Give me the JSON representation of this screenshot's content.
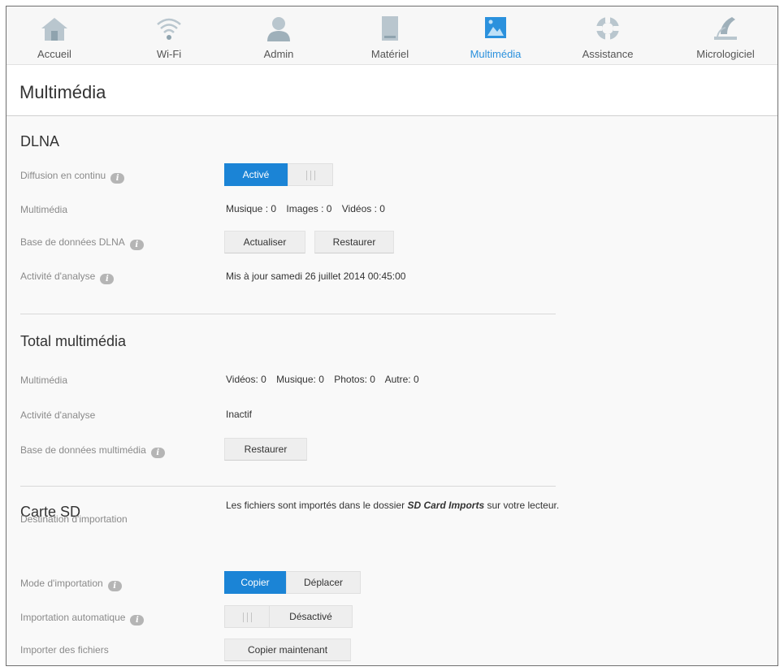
{
  "nav": {
    "items": [
      {
        "label": "Accueil",
        "icon": "home-icon"
      },
      {
        "label": "Wi-Fi",
        "icon": "wifi-icon"
      },
      {
        "label": "Admin",
        "icon": "admin-user-icon"
      },
      {
        "label": "Matériel",
        "icon": "hardware-icon"
      },
      {
        "label": "Multimédia",
        "icon": "multimedia-icon"
      },
      {
        "label": "Assistance",
        "icon": "lifebuoy-icon"
      },
      {
        "label": "Micrologiciel",
        "icon": "firmware-icon"
      }
    ],
    "active": "Multimédia",
    "active_color": "#2b91dd",
    "inactive_icon_color": "#b9c6ce"
  },
  "page": {
    "title": "Multimédia"
  },
  "dlna": {
    "title": "DLNA",
    "streaming_label": "Diffusion en continu",
    "streaming_on": "Activé",
    "media_label": "Multimédia",
    "media_music": "Musique : 0",
    "media_images": "Images : 0",
    "media_videos": "Vidéos : 0",
    "db_label": "Base de données DLNA",
    "refresh_button": "Actualiser",
    "restore_button": "Restaurer",
    "scan_label": "Activité d'analyse",
    "scan_value": "Mis à jour samedi 26 juillet 2014 00:45:00"
  },
  "total": {
    "title": "Total multimédia",
    "media_label": "Multimédia",
    "videos": "Vidéos: 0",
    "music": "Musique: 0",
    "photos": "Photos: 0",
    "other": "Autre: 0",
    "scan_label": "Activité d'analyse",
    "scan_value": "Inactif",
    "db_label": "Base de données multimédia",
    "restore_button": "Restaurer"
  },
  "sd": {
    "title": "Carte SD",
    "dest_label": "Destination d'importation",
    "dest_text_before": "Les fichiers sont importés dans le dossier ",
    "dest_folder": "SD Card Imports",
    "dest_text_after": " sur votre lecteur.",
    "mode_label": "Mode d'importation",
    "mode_copy": "Copier",
    "mode_move": "Déplacer",
    "auto_label": "Importation automatique",
    "auto_off": "Désactivé",
    "import_label": "Importer des fichiers",
    "copy_now_button": "Copier maintenant"
  },
  "colors": {
    "accent": "#1b84d6",
    "button_bg": "#eeeeee"
  }
}
